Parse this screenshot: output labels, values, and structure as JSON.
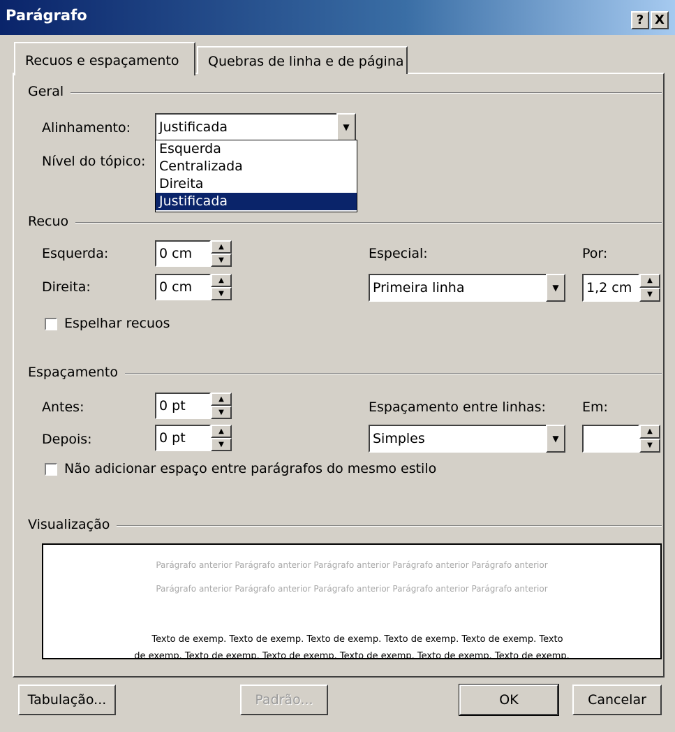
{
  "window": {
    "title": "Parágrafo",
    "help_glyph": "?",
    "close_glyph": "X"
  },
  "tabs": [
    {
      "label": "Recuos e espaçamento",
      "active": true
    },
    {
      "label": "Quebras de linha e de página",
      "active": false
    }
  ],
  "geral": {
    "header": "Geral",
    "alinhamento_label": "Alinhamento:",
    "alinhamento_value": "Justificada",
    "nivel_label": "Nível do tópico:",
    "dropdown_options": [
      "Esquerda",
      "Centralizada",
      "Direita",
      "Justificada"
    ],
    "dropdown_selected": "Justificada"
  },
  "recuo": {
    "header": "Recuo",
    "esquerda_label": "Esquerda:",
    "esquerda_value": "0 cm",
    "direita_label": "Direita:",
    "direita_value": "0 cm",
    "especial_label": "Especial:",
    "especial_value": "Primeira linha",
    "por_label": "Por:",
    "por_value": "1,2 cm",
    "espelhar_label": "Espelhar recuos",
    "espelhar_checked": false
  },
  "espacamento": {
    "header": "Espaçamento",
    "antes_label": "Antes:",
    "antes_value": "0 pt",
    "depois_label": "Depois:",
    "depois_value": "0 pt",
    "entre_linhas_label": "Espaçamento entre linhas:",
    "entre_linhas_value": "Simples",
    "em_label": "Em:",
    "em_value": "",
    "nao_adicionar_label": "Não adicionar espaço entre parágrafos do mesmo estilo",
    "nao_adicionar_checked": false
  },
  "visualizacao": {
    "header": "Visualização",
    "previous_line_1": "Parágrafo anterior Parágrafo anterior Parágrafo anterior Parágrafo anterior Parágrafo anterior",
    "previous_line_2": "Parágrafo anterior Parágrafo anterior Parágrafo anterior Parágrafo anterior Parágrafo anterior",
    "sample_line_1": "Texto de exemp. Texto de exemp. Texto de exemp. Texto de exemp. Texto de exemp. Texto",
    "sample_line_2": "de exemp. Texto de exemp. Texto de exemp. Texto de exemp. Texto de exemp. Texto de exemp."
  },
  "buttons": {
    "tabulacao": "Tabulação...",
    "padrao": "Padrão...",
    "ok": "OK",
    "cancelar": "Cancelar"
  },
  "colors": {
    "title_bar": "#0a246a",
    "dialog_bg": "#d4d0c8",
    "selection": "#0a246a"
  }
}
